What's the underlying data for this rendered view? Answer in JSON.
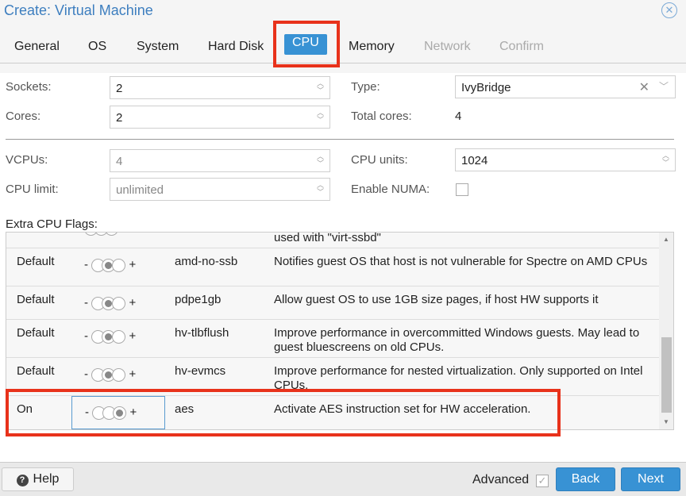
{
  "window": {
    "title": "Create: Virtual Machine",
    "close_icon": "close-circle-icon"
  },
  "tabs": [
    {
      "label": "General"
    },
    {
      "label": "OS"
    },
    {
      "label": "System"
    },
    {
      "label": "Hard Disk"
    },
    {
      "label": "CPU",
      "active": true
    },
    {
      "label": "Memory"
    },
    {
      "label": "Network",
      "disabled": true
    },
    {
      "label": "Confirm",
      "disabled": true
    }
  ],
  "form": {
    "sockets": {
      "label": "Sockets:",
      "value": "2"
    },
    "cores": {
      "label": "Cores:",
      "value": "2"
    },
    "type": {
      "label": "Type:",
      "value": "IvyBridge"
    },
    "total_cores": {
      "label": "Total cores:",
      "value": "4"
    },
    "vcpus": {
      "label": "VCPUs:",
      "value": "4"
    },
    "cpu_limit": {
      "label": "CPU limit:",
      "value": "unlimited"
    },
    "cpu_units": {
      "label": "CPU units:",
      "value": "1024"
    },
    "numa": {
      "label": "Enable NUMA:",
      "checked": false
    }
  },
  "flags": {
    "label": "Extra CPU Flags:",
    "partial_desc": "used with \"virt-ssbd\"",
    "rows": [
      {
        "state": "Default",
        "level": 1,
        "name": "amd-no-ssb",
        "desc": "Notifies guest OS that host is not vulnerable for Spectre on AMD CPUs"
      },
      {
        "state": "Default",
        "level": 1,
        "name": "pdpe1gb",
        "desc": "Allow guest OS to use 1GB size pages, if host HW supports it"
      },
      {
        "state": "Default",
        "level": 1,
        "name": "hv-tlbflush",
        "desc": "Improve performance in overcommitted Windows guests. May lead to guest bluescreens on old CPUs."
      },
      {
        "state": "Default",
        "level": 1,
        "name": "hv-evmcs",
        "desc": "Improve performance for nested virtualization. Only supported on Intel CPUs."
      },
      {
        "state": "On",
        "level": 2,
        "name": "aes",
        "desc": "Activate AES instruction set for HW acceleration."
      }
    ],
    "minus": "-",
    "plus": "+"
  },
  "footer": {
    "help": "Help",
    "advanced": "Advanced",
    "advanced_checked": true,
    "back": "Back",
    "next": "Next"
  },
  "colors": {
    "accent": "#3892d4",
    "highlight": "#e8321b"
  }
}
